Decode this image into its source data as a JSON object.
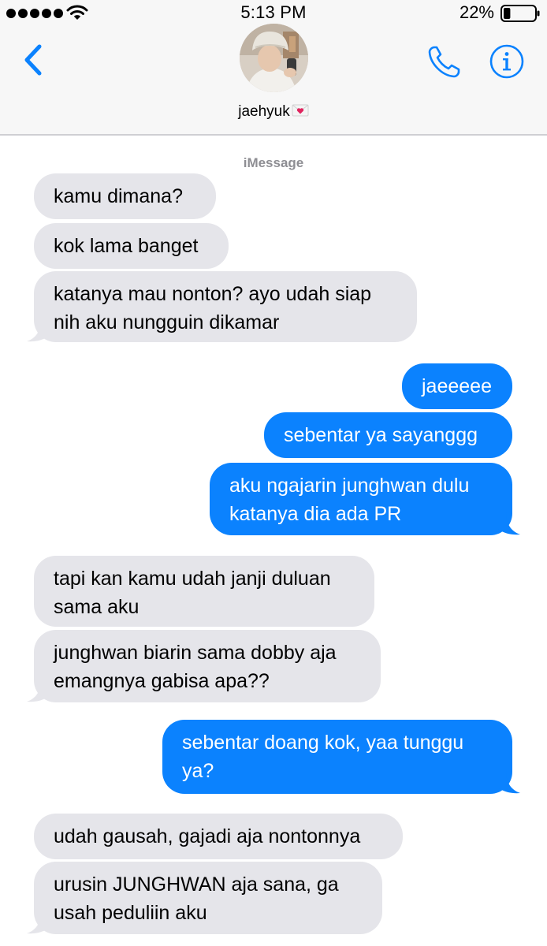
{
  "status_bar": {
    "time": "5:13 PM",
    "battery_percent": "22%",
    "battery_level": 0.22,
    "signal_icon": "signal-dots-icon",
    "wifi_icon": "wifi-icon",
    "battery_icon": "battery-icon"
  },
  "header": {
    "contact_name": "jaehyuk",
    "name_emoji_icon": "heart-letter-icon",
    "back_icon": "chevron-left-icon",
    "call_icon": "phone-icon",
    "info_icon": "info-icon"
  },
  "conversation": {
    "service_label": "iMessage",
    "messages": [
      {
        "direction": "incoming",
        "text": "kamu dimana?"
      },
      {
        "direction": "incoming",
        "text": "kok lama banget"
      },
      {
        "direction": "incoming",
        "text": "katanya mau nonton? ayo udah siap\nnih aku nungguin dikamar"
      },
      {
        "direction": "outgoing",
        "text": "jaeeeee"
      },
      {
        "direction": "outgoing",
        "text": "sebentar ya sayanggg"
      },
      {
        "direction": "outgoing",
        "text": "aku ngajarin junghwan dulu\nkatanya dia ada PR"
      },
      {
        "direction": "incoming",
        "text": "tapi kan kamu udah janji duluan\nsama aku"
      },
      {
        "direction": "incoming",
        "text": "junghwan biarin sama dobby aja\nemangnya gabisa apa??"
      },
      {
        "direction": "outgoing",
        "text": "sebentar doang kok, yaa tunggu\nya?"
      },
      {
        "direction": "incoming",
        "text": "udah gausah, gajadi aja nontonnya"
      },
      {
        "direction": "incoming",
        "text": "urusin JUNGHWAN aja sana, ga\nusah peduliin aku"
      }
    ]
  },
  "colors": {
    "accent": "#0b82fe",
    "incoming_bubble": "#e5e5ea",
    "header_bg": "#f7f7f7",
    "secondary_text": "#8e8e93"
  }
}
